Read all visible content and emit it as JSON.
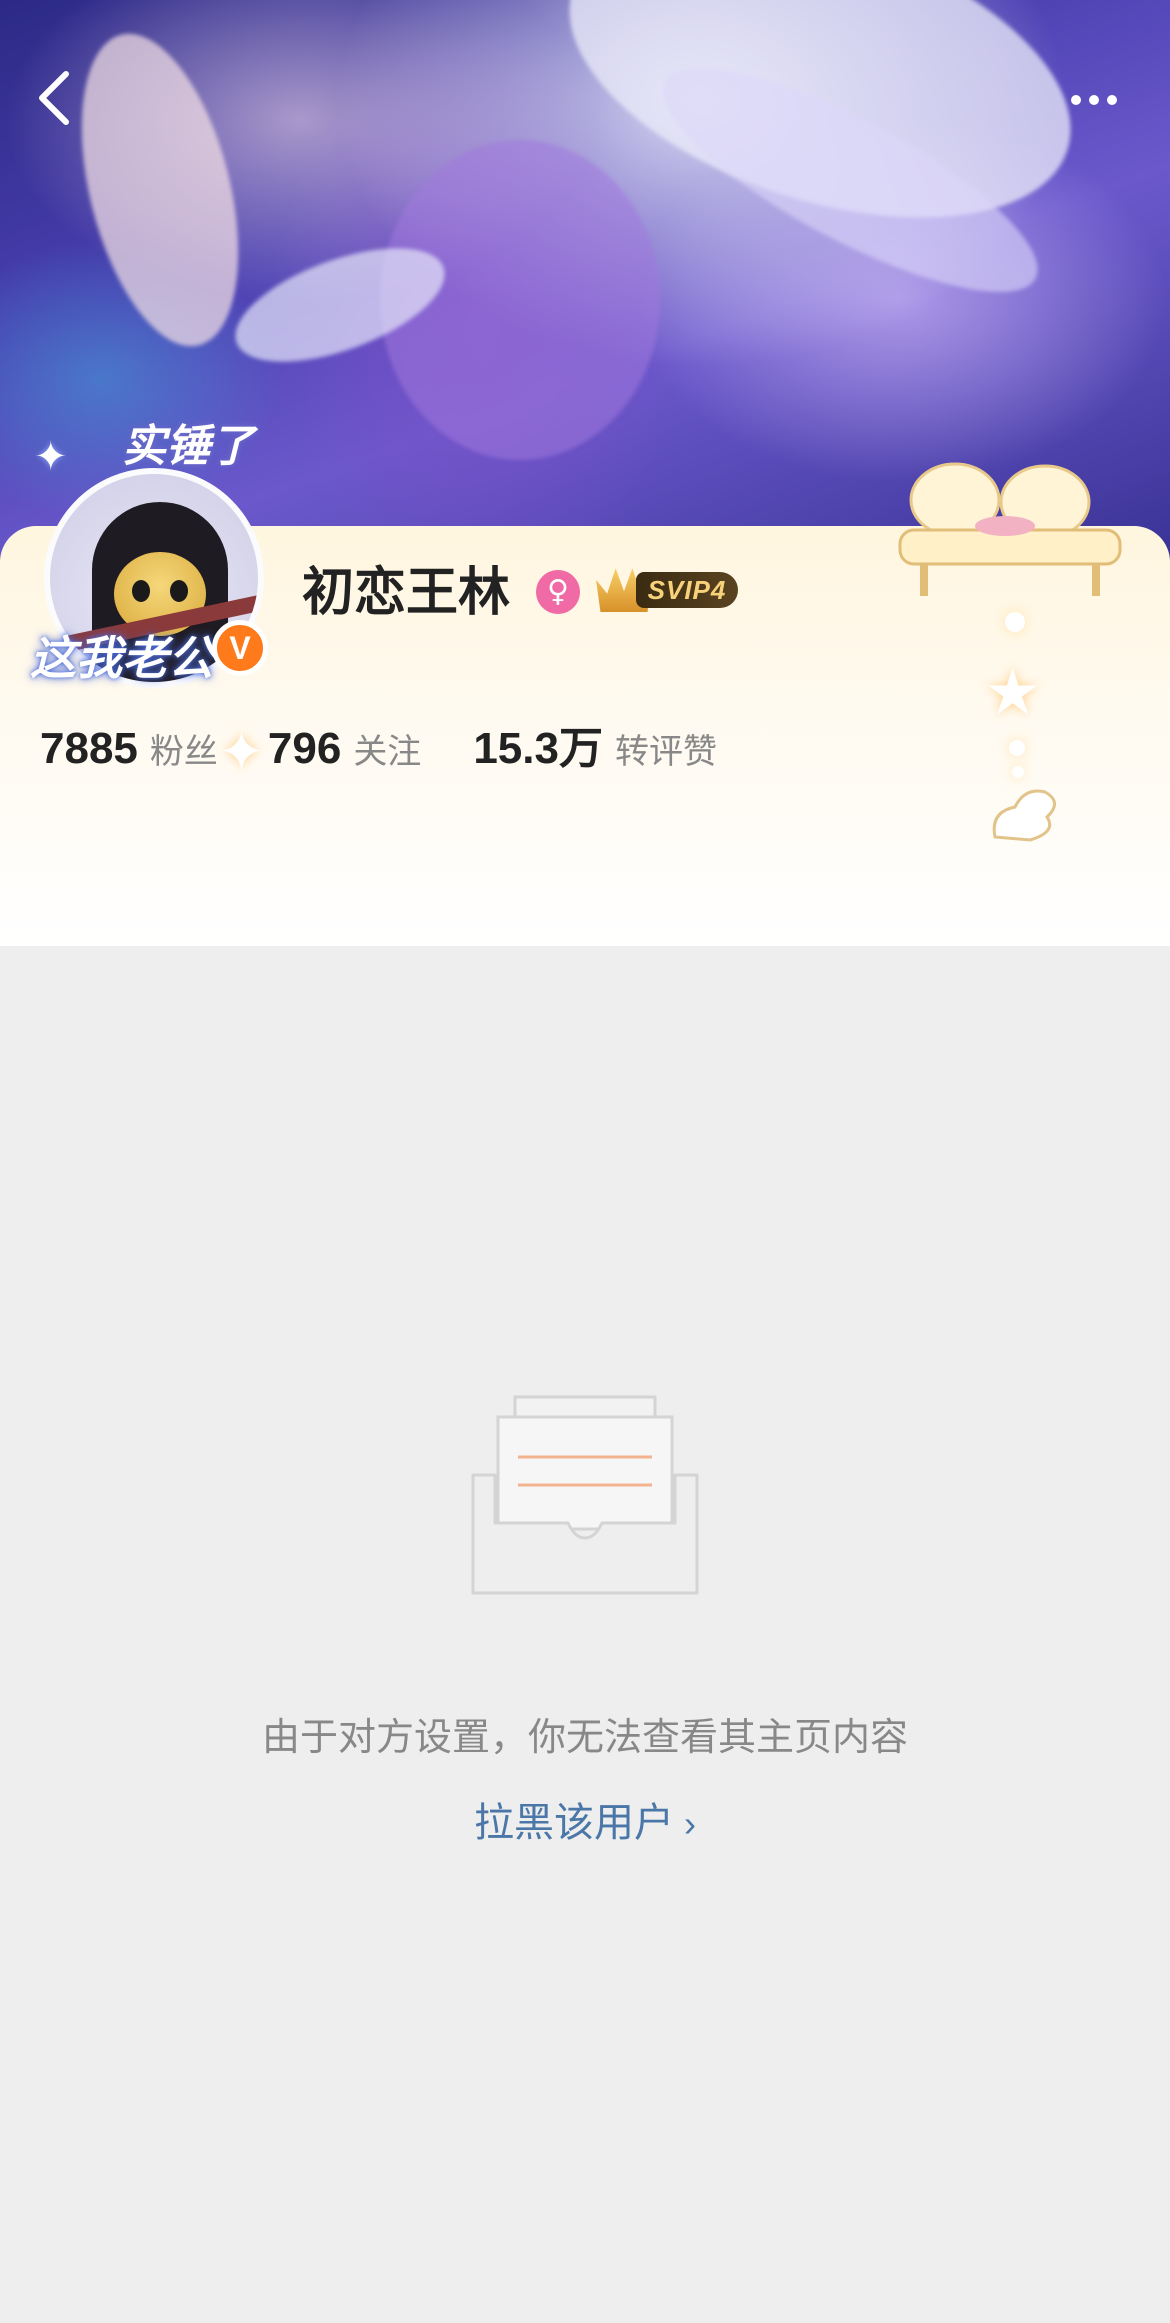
{
  "profile": {
    "username": "初恋王林",
    "gender_icon": "female-icon",
    "gender_symbol": "♀",
    "vip_label": "SVIP4",
    "verified_symbol": "V",
    "avatar_text_top": "实锤了",
    "avatar_text_bottom": "这我老公"
  },
  "stats": [
    {
      "value": "7885",
      "label": "粉丝"
    },
    {
      "value": "796",
      "label": "关注"
    },
    {
      "value": "15.3万",
      "label": "转评赞"
    }
  ],
  "navigation": {
    "back_icon": "chevron-left-icon",
    "more_icon": "more-dots-icon"
  },
  "empty_state": {
    "icon": "empty-inbox-icon",
    "message": "由于对方设置，你无法查看其主页内容",
    "action_label": "拉黑该用户",
    "action_chevron": "›"
  },
  "colors": {
    "background": "#eeeeee",
    "link": "#4a77a8",
    "verified": "#ff7a1a",
    "gender": "#f06aa6"
  }
}
